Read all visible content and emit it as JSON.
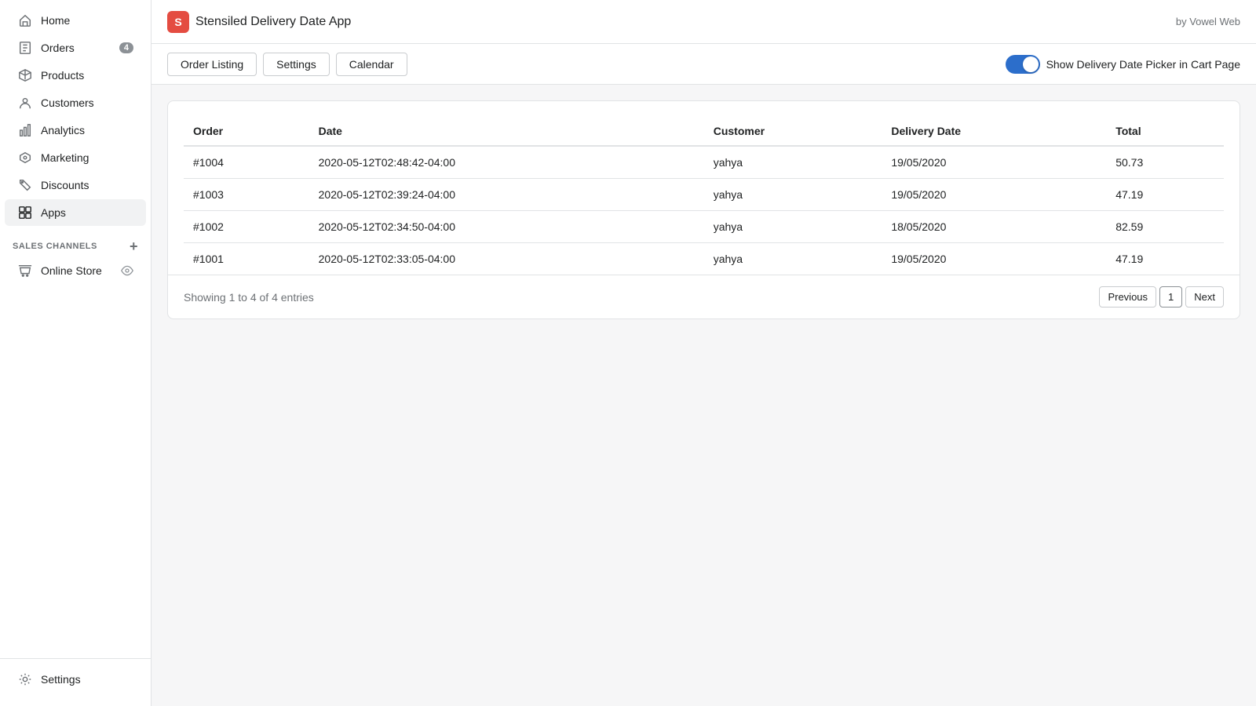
{
  "sidebar": {
    "items": [
      {
        "id": "home",
        "label": "Home",
        "icon": "home-icon",
        "active": false
      },
      {
        "id": "orders",
        "label": "Orders",
        "icon": "orders-icon",
        "active": false,
        "badge": "4"
      },
      {
        "id": "products",
        "label": "Products",
        "icon": "products-icon",
        "active": false
      },
      {
        "id": "customers",
        "label": "Customers",
        "icon": "customers-icon",
        "active": false
      },
      {
        "id": "analytics",
        "label": "Analytics",
        "icon": "analytics-icon",
        "active": false
      },
      {
        "id": "marketing",
        "label": "Marketing",
        "icon": "marketing-icon",
        "active": false
      },
      {
        "id": "discounts",
        "label": "Discounts",
        "icon": "discounts-icon",
        "active": false
      },
      {
        "id": "apps",
        "label": "Apps",
        "icon": "apps-icon",
        "active": true
      }
    ],
    "sales_channels_label": "SALES CHANNELS",
    "online_store_label": "Online Store",
    "settings_label": "Settings"
  },
  "topbar": {
    "app_logo_letter": "S",
    "app_title": "Stensiled Delivery Date App",
    "by_label": "by Vowel Web"
  },
  "actionbar": {
    "order_listing_label": "Order Listing",
    "settings_label": "Settings",
    "calendar_label": "Calendar",
    "toggle_label": "Show Delivery Date Picker in Cart Page"
  },
  "table": {
    "columns": [
      "Order",
      "Date",
      "Customer",
      "Delivery Date",
      "Total"
    ],
    "rows": [
      {
        "order": "#1004",
        "date": "2020-05-12T02:48:42-04:00",
        "customer": "yahya",
        "delivery_date": "19/05/2020",
        "total": "50.73"
      },
      {
        "order": "#1003",
        "date": "2020-05-12T02:39:24-04:00",
        "customer": "yahya",
        "delivery_date": "19/05/2020",
        "total": "47.19"
      },
      {
        "order": "#1002",
        "date": "2020-05-12T02:34:50-04:00",
        "customer": "yahya",
        "delivery_date": "18/05/2020",
        "total": "82.59"
      },
      {
        "order": "#1001",
        "date": "2020-05-12T02:33:05-04:00",
        "customer": "yahya",
        "delivery_date": "19/05/2020",
        "total": "47.19"
      }
    ],
    "showing_text": "Showing 1 to 4 of 4 entries"
  },
  "pagination": {
    "previous_label": "Previous",
    "next_label": "Next",
    "current_page": "1"
  }
}
